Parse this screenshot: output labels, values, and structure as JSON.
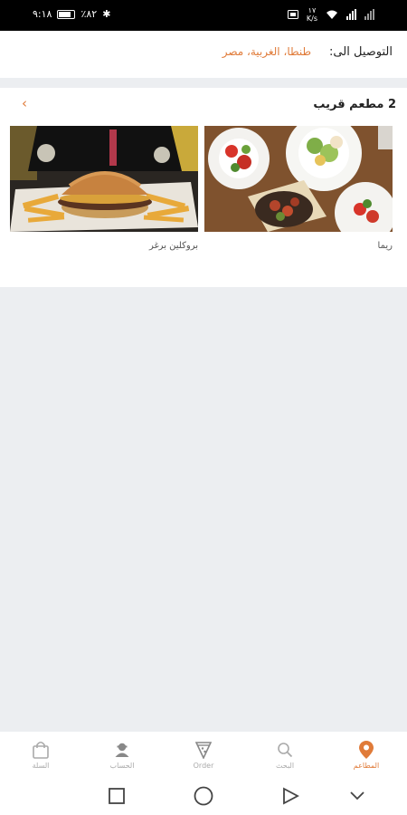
{
  "status_bar": {
    "time": "٩:١٨",
    "battery": "٪٨٢",
    "net_speed_top": "١٧",
    "net_speed_unit": "K/s"
  },
  "delivery": {
    "label": "التوصيل الى:",
    "location": "طنطا، الغربية، مصر"
  },
  "nearby": {
    "title": "2 مطعم قريب",
    "restaurants": [
      {
        "name": "ريما",
        "image": "salad-plates-photo"
      },
      {
        "name": "بروكلين برغر",
        "image": "giant-burger-photo"
      }
    ]
  },
  "bottom_nav": {
    "items": [
      {
        "label": "المطاعم",
        "icon": "location-pin-icon",
        "active": true
      },
      {
        "label": "البحث",
        "icon": "search-icon",
        "active": false
      },
      {
        "label": "Order",
        "icon": "pizza-slice-icon",
        "active": false
      },
      {
        "label": "الحساب",
        "icon": "user-icon",
        "active": false
      },
      {
        "label": "السلة",
        "icon": "shopping-bag-icon",
        "active": false
      }
    ]
  },
  "colors": {
    "accent": "#e07b39",
    "background": "#eceef1"
  }
}
